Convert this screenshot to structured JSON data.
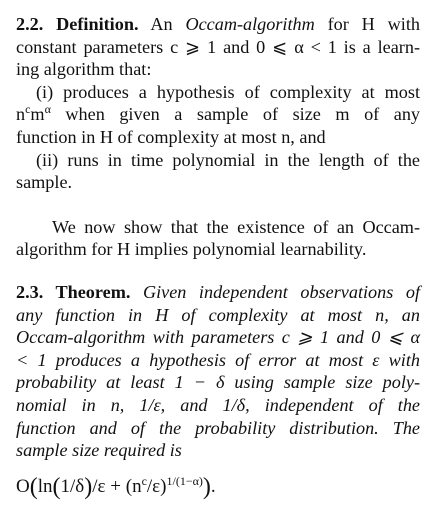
{
  "definition": {
    "heading": "2.2. Definition.",
    "lines": [
      [
        "An ",
        "Occam-algorithm",
        " for H with"
      ],
      [
        "constant parameters c ⩾ 1 and 0 ⩽ α < 1 is a learn-"
      ],
      [
        "ing algorithm that:"
      ],
      [
        "(i) produces a hypothesis of complexity at most"
      ],
      [
        "when given a sample of size m of any"
      ],
      [
        "function in H of complexity at most n, and"
      ],
      [
        "(ii) runs in time polynomial in the length of the"
      ],
      [
        "sample."
      ]
    ],
    "line5_prefix_base1": "n",
    "line5_prefix_sup1": "c",
    "line5_prefix_base2": "m",
    "line5_prefix_sup2": "α"
  },
  "transition": {
    "lines": [
      "We now show that the existence of an Occam-",
      "algorithm for H implies polynomial learnability."
    ]
  },
  "theorem": {
    "heading": "2.3. Theorem.",
    "lines": [
      "Given independent observations of",
      "any function in H of complexity at most n, an",
      "Occam-algorithm with parameters c ⩾ 1 and 0 ⩽ α",
      "< 1 produces a hypothesis of error at most ε with",
      "probability at least 1 − δ using sample size poly-",
      "nomial in n, 1/ε, and 1/δ, independent of the",
      "function and of the probability distribution. The",
      "sample size required is"
    ]
  },
  "formula": {
    "prefix": "O",
    "open_paren": "(",
    "ln_part": "ln",
    "ln_paren_open": "(",
    "ln_arg": "1/δ",
    "ln_paren_close": ")",
    "after_ln": "/ε + ",
    "inner_paren_open": "(",
    "n_base": "n",
    "n_sup": "c",
    "after_n": "/ε",
    "inner_paren_close": ")",
    "exponent": "1/(1−α)",
    "close_paren": ")",
    "end": "."
  }
}
